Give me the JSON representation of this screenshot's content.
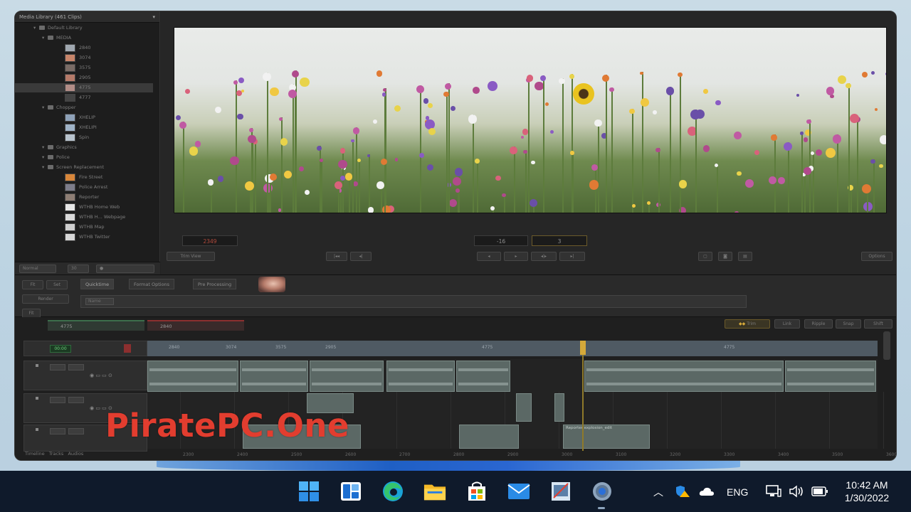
{
  "library": {
    "header": "Media Library (461 Clips)",
    "close": "▾",
    "rows": [
      {
        "label": "Default Library",
        "level": 1,
        "type": "folder"
      },
      {
        "label": "MEDIA",
        "level": 2,
        "type": "folder"
      },
      {
        "label": "2840",
        "level": 3,
        "type": "clip",
        "color": "#a0a8b0"
      },
      {
        "label": "3074",
        "level": 3,
        "type": "clip",
        "color": "#c7856a"
      },
      {
        "label": "3575",
        "level": 3,
        "type": "clip",
        "color": "#7a6c66"
      },
      {
        "label": "2905",
        "level": 3,
        "type": "clip",
        "color": "#b57a69"
      },
      {
        "label": "4775",
        "level": 3,
        "type": "clip",
        "color": "#b28d87",
        "selected": true
      },
      {
        "label": "4777",
        "level": 3,
        "type": "clip",
        "color": "#444444"
      },
      {
        "label": "Chopper",
        "level": 2,
        "type": "folder"
      },
      {
        "label": "XHELIP",
        "level": 3,
        "type": "clip",
        "color": "#8ea1b8"
      },
      {
        "label": "XHELIPI",
        "level": 3,
        "type": "clip",
        "color": "#9fb3c7"
      },
      {
        "label": "Spin",
        "level": 3,
        "type": "clip",
        "color": "#b8c3cd"
      },
      {
        "label": "Graphics",
        "level": 2,
        "type": "folder"
      },
      {
        "label": "Police",
        "level": 2,
        "type": "folder"
      },
      {
        "label": "Screen Replacement",
        "level": 2,
        "type": "folder"
      },
      {
        "label": "Fire Street",
        "level": 3,
        "type": "clip",
        "color": "#d8863a"
      },
      {
        "label": "Police Arrest",
        "level": 3,
        "type": "clip",
        "color": "#7d7d8a"
      },
      {
        "label": "Reporter",
        "level": 3,
        "type": "clip",
        "color": "#8e7e74"
      },
      {
        "label": "WTHB Home Web",
        "level": 3,
        "type": "clip",
        "color": "#e6e6e6"
      },
      {
        "label": "WTHB H... Webpage",
        "level": 3,
        "type": "clip",
        "color": "#dadada"
      },
      {
        "label": "WTHB Map",
        "level": 3,
        "type": "clip",
        "color": "#cfcfcf"
      },
      {
        "label": "WTHB Twitter",
        "level": 3,
        "type": "clip",
        "color": "#d7d7d7"
      }
    ],
    "footer": {
      "view": "Normal",
      "size": "30"
    }
  },
  "viewer": {
    "timecode_left": "2349",
    "timecode_center": "-16",
    "timecode_right": "3",
    "view_mode": "Trim View",
    "zoom": "Options",
    "transport": [
      "|◂◂",
      "◂|",
      "◂",
      "▸",
      "◂|▸",
      "▸|"
    ]
  },
  "mid": {
    "tabs": [
      "Quicktime",
      "Format Options",
      "Pre Processing"
    ],
    "left_buttons": [
      "Fit",
      "Set",
      "Render",
      "Fit"
    ],
    "field_placeholder": "Name"
  },
  "timeline": {
    "sequence_tabs": [
      {
        "label": "4775",
        "color": "#3c6e4c"
      },
      {
        "label": "2840",
        "color": "#8c2f2f"
      }
    ],
    "tools": [
      "Trim",
      "Link",
      "Ripple",
      "Snap",
      "Shift"
    ],
    "ruler_top": [
      "2840",
      "3074",
      "3575",
      "2905",
      "4775",
      "4775"
    ],
    "ruler_bottom": [
      "2300",
      "2400",
      "2500",
      "2600",
      "2700",
      "2800",
      "2900",
      "3000",
      "3100",
      "3200",
      "3300",
      "3400",
      "3500",
      "3600"
    ],
    "bottom_tabs": [
      "Timeline",
      "Tracks",
      "Audios"
    ],
    "clip_label": "Reporter explosion_edit"
  },
  "watermark": "PiratePC.One",
  "taskbar": {
    "icons": [
      "windows-start-icon",
      "widgets-icon",
      "edge-browser-icon",
      "file-explorer-icon",
      "microsoft-store-icon",
      "mail-icon",
      "snipping-tool-icon",
      "settings-icon"
    ],
    "lang": "ENG",
    "time": "10:42 AM",
    "date": "1/30/2022"
  },
  "colors": {
    "accent": "#e23d2f",
    "taskbar": "#0f1a2b",
    "app_bg": "#232323"
  }
}
